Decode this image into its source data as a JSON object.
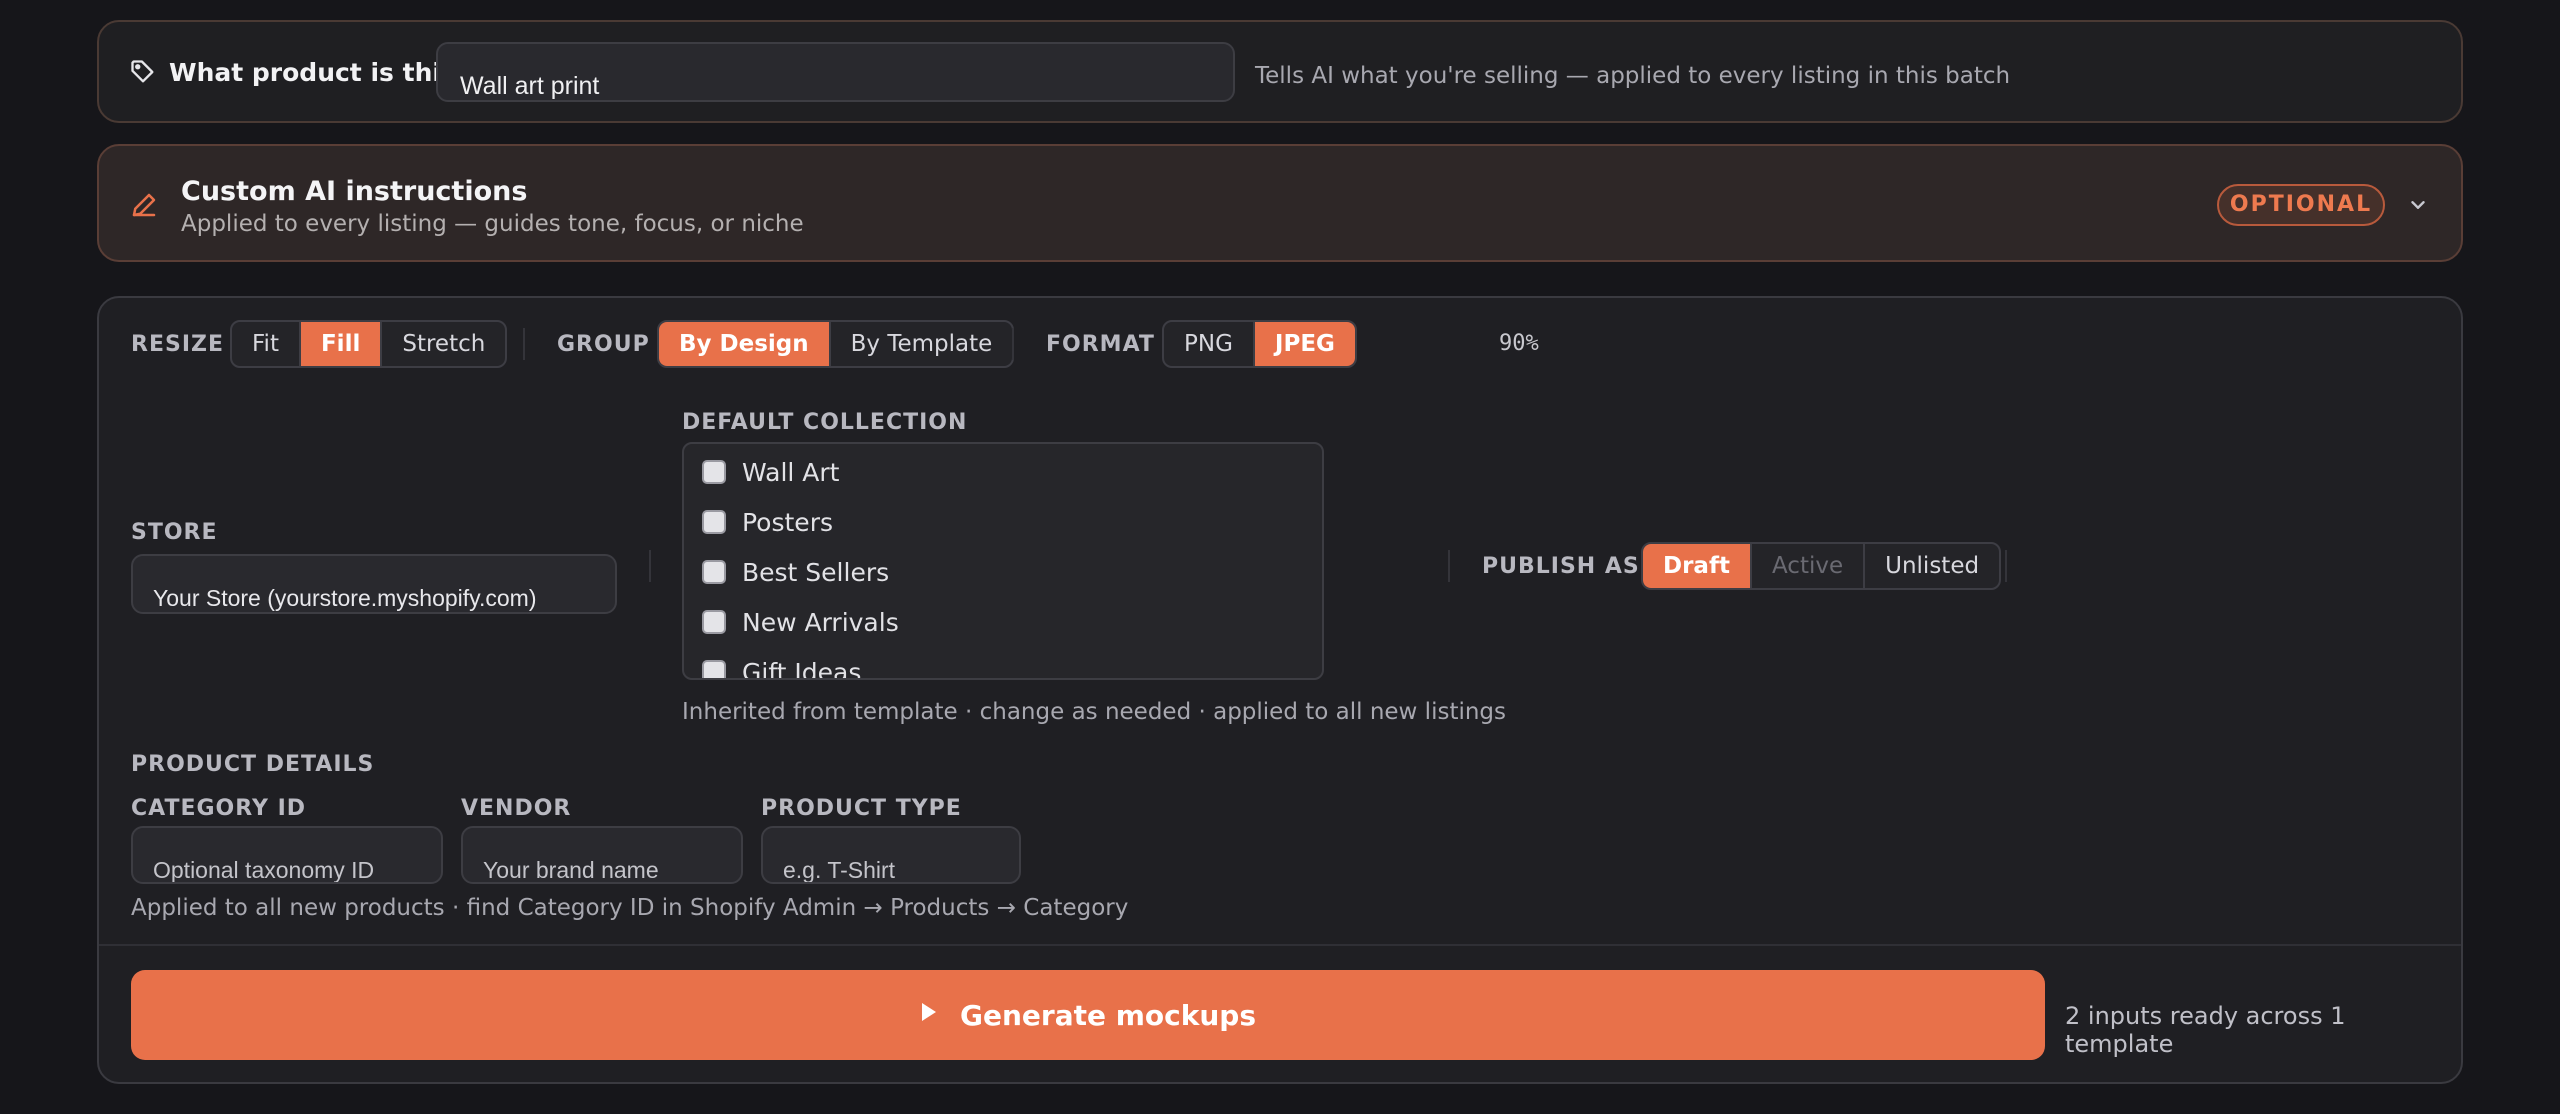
{
  "product": {
    "question": "What product is this?",
    "value": "Wall art print",
    "hint": "Tells AI what you're selling — applied to every listing in this batch"
  },
  "instructions": {
    "title": "Custom AI instructions",
    "subtitle": "Applied to every listing — guides tone, focus, or niche",
    "badge": "OPTIONAL"
  },
  "settings": {
    "resize": {
      "label": "RESIZE",
      "options": [
        "Fit",
        "Fill",
        "Stretch"
      ],
      "selected": "Fill"
    },
    "group": {
      "label": "GROUP",
      "options": [
        "By Design",
        "By Template"
      ],
      "selected": "By Design"
    },
    "format": {
      "label": "FORMAT",
      "options": [
        "PNG",
        "JPEG"
      ],
      "selected": "JPEG",
      "quality": "90%"
    },
    "store": {
      "label": "STORE",
      "value": "Your Store (yourstore.myshopify.com)"
    },
    "collection": {
      "label": "DEFAULT COLLECTION",
      "items": [
        "Wall Art",
        "Posters",
        "Best Sellers",
        "New Arrivals",
        "Gift Ideas"
      ],
      "note": "Inherited from template · change as needed · applied to all new listings"
    },
    "publish": {
      "label": "PUBLISH AS",
      "options": [
        "Draft",
        "Active",
        "Unlisted"
      ],
      "selected": "Draft"
    },
    "details": {
      "label": "PRODUCT DETAILS",
      "category": {
        "label": "CATEGORY ID",
        "placeholder": "Optional taxonomy ID"
      },
      "vendor": {
        "label": "VENDOR",
        "placeholder": "Your brand name"
      },
      "type": {
        "label": "PRODUCT TYPE",
        "placeholder": "e.g. T-Shirt"
      },
      "note": "Applied to all new products · find Category ID in Shopify Admin → Products → Category"
    }
  },
  "generate": {
    "button": "Generate mockups",
    "status": "2 inputs ready across 1 template"
  },
  "colors": {
    "accent": "#e8714a",
    "background": "#16161a",
    "card": "#1f1f23"
  }
}
